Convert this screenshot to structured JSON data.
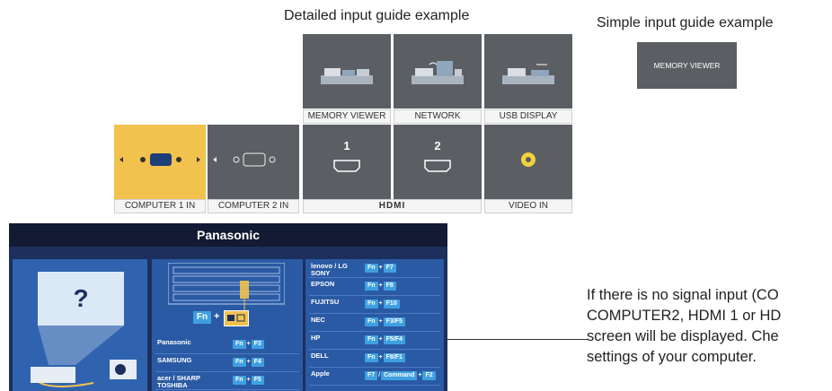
{
  "headings": {
    "detailed": "Detailed input guide example",
    "simple": "Simple input guide example"
  },
  "detailed_guide": {
    "top_row": [
      {
        "label": "MEMORY VIEWER",
        "icon": "memory-viewer-icon"
      },
      {
        "label": "NETWORK",
        "icon": "network-icon"
      },
      {
        "label": "USB DISPLAY",
        "icon": "usb-display-icon"
      }
    ],
    "bottom_row": [
      {
        "label": "COMPUTER 1 IN",
        "icon": "vga-port-icon",
        "selected": true
      },
      {
        "label": "COMPUTER 2 IN",
        "icon": "vga-port-icon"
      },
      {
        "label": "1",
        "icon": "hdmi-port-icon"
      },
      {
        "label": "2",
        "icon": "hdmi-port-icon"
      },
      {
        "label": "VIDEO IN",
        "icon": "rca-jack-icon"
      }
    ],
    "hdmi_caption": "HDMI",
    "selected_color": "#f2c24e",
    "tile_color": "#5b5e62"
  },
  "simple_guide": {
    "label": "MEMORY VIEWER"
  },
  "no_signal_screen": {
    "title": "Panasonic",
    "question": "?",
    "fn_key": "Fn",
    "left_brands": [
      {
        "name": "Panasonic",
        "keys": [
          "Fn",
          "F3"
        ]
      },
      {
        "name": "SAMSUNG",
        "keys": [
          "Fn",
          "F4"
        ]
      },
      {
        "name": "acer / SHARP\nTOSHIBA",
        "keys": [
          "Fn",
          "F5"
        ]
      }
    ],
    "right_brands": [
      {
        "name": "lenovo / LG\nSONY",
        "keys": [
          "Fn",
          "F7"
        ]
      },
      {
        "name": "EPSON",
        "keys": [
          "Fn",
          "F8"
        ]
      },
      {
        "name": "FUJITSU",
        "keys": [
          "Fn",
          "F10"
        ]
      },
      {
        "name": "NEC",
        "keys": [
          "Fn",
          "F3/F5"
        ]
      },
      {
        "name": "HP",
        "keys": [
          "Fn",
          "F5/F4"
        ]
      },
      {
        "name": "DELL",
        "keys": [
          "Fn",
          "F8/F1"
        ]
      },
      {
        "name": "Apple",
        "keys": [
          "F7",
          "Command",
          "F2"
        ]
      }
    ]
  },
  "note": {
    "lines": [
      "If there is no signal input (CO",
      "COMPUTER2, HDMI 1 or HD",
      "screen will be displayed. Che",
      "settings of your computer."
    ]
  }
}
